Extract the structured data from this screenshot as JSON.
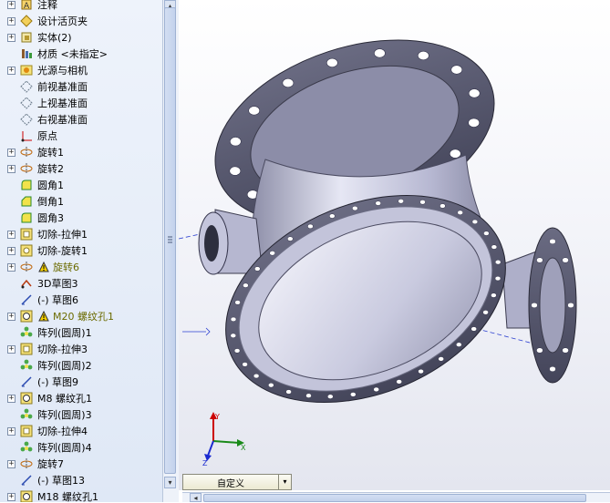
{
  "tree": {
    "items": [
      {
        "label": "注释",
        "expander": "+",
        "icon": "annotation-icon"
      },
      {
        "label": "设计活页夹",
        "expander": "+",
        "icon": "design-binder-icon"
      },
      {
        "label": "实体(2)",
        "expander": "+",
        "icon": "solid-bodies-icon"
      },
      {
        "label": "材质 <未指定>",
        "expander": "",
        "icon": "material-icon"
      },
      {
        "label": "光源与相机",
        "expander": "+",
        "icon": "lights-camera-icon"
      },
      {
        "label": "前视基准面",
        "expander": "",
        "icon": "plane-icon"
      },
      {
        "label": "上视基准面",
        "expander": "",
        "icon": "plane-icon"
      },
      {
        "label": "右视基准面",
        "expander": "",
        "icon": "plane-icon"
      },
      {
        "label": "原点",
        "expander": "",
        "icon": "origin-icon"
      },
      {
        "label": "旋转1",
        "expander": "+",
        "icon": "revolve-icon"
      },
      {
        "label": "旋转2",
        "expander": "+",
        "icon": "revolve-icon"
      },
      {
        "label": "圆角1",
        "expander": "",
        "icon": "fillet-icon"
      },
      {
        "label": "倒角1",
        "expander": "",
        "icon": "chamfer-icon"
      },
      {
        "label": "圆角3",
        "expander": "",
        "icon": "fillet-icon"
      },
      {
        "label": "切除-拉伸1",
        "expander": "+",
        "icon": "cut-extrude-icon"
      },
      {
        "label": "切除-旋转1",
        "expander": "+",
        "icon": "cut-revolve-icon"
      },
      {
        "label": "旋转6",
        "expander": "+",
        "icon": "revolve-warning-icon",
        "warn": true
      },
      {
        "label": "3D草图3",
        "expander": "",
        "icon": "3d-sketch-icon"
      },
      {
        "label": "(-) 草图6",
        "expander": "",
        "icon": "sketch-icon"
      },
      {
        "label": "M20 螺纹孔1",
        "expander": "+",
        "icon": "hole-warning-icon",
        "warn": true
      },
      {
        "label": "阵列(圆周)1",
        "expander": "",
        "icon": "circular-pattern-icon"
      },
      {
        "label": "切除-拉伸3",
        "expander": "+",
        "icon": "cut-extrude-icon"
      },
      {
        "label": "阵列(圆周)2",
        "expander": "",
        "icon": "circular-pattern-icon"
      },
      {
        "label": "(-) 草图9",
        "expander": "",
        "icon": "sketch-icon"
      },
      {
        "label": "M8 螺纹孔1",
        "expander": "+",
        "icon": "hole-icon"
      },
      {
        "label": "阵列(圆周)3",
        "expander": "",
        "icon": "circular-pattern-icon"
      },
      {
        "label": "切除-拉伸4",
        "expander": "+",
        "icon": "cut-extrude-icon"
      },
      {
        "label": "阵列(圆周)4",
        "expander": "",
        "icon": "circular-pattern-icon"
      },
      {
        "label": "旋转7",
        "expander": "+",
        "icon": "revolve-icon"
      },
      {
        "label": "(-) 草图13",
        "expander": "",
        "icon": "sketch-icon"
      },
      {
        "label": "M18 螺纹孔1",
        "expander": "+",
        "icon": "hole-icon"
      }
    ]
  },
  "viewport": {
    "triad": {
      "x": "X",
      "y": "Y",
      "z": "Z"
    },
    "colors": {
      "flange": "#55566a",
      "body": "#c8c9de",
      "hole": "#ffffff",
      "axis": "#2b3fd0"
    }
  },
  "statusbar": {
    "view_combo": "自定义",
    "combo_arrow": "▾"
  },
  "scroll": {
    "up": "▴",
    "down": "▾",
    "left": "◂"
  }
}
